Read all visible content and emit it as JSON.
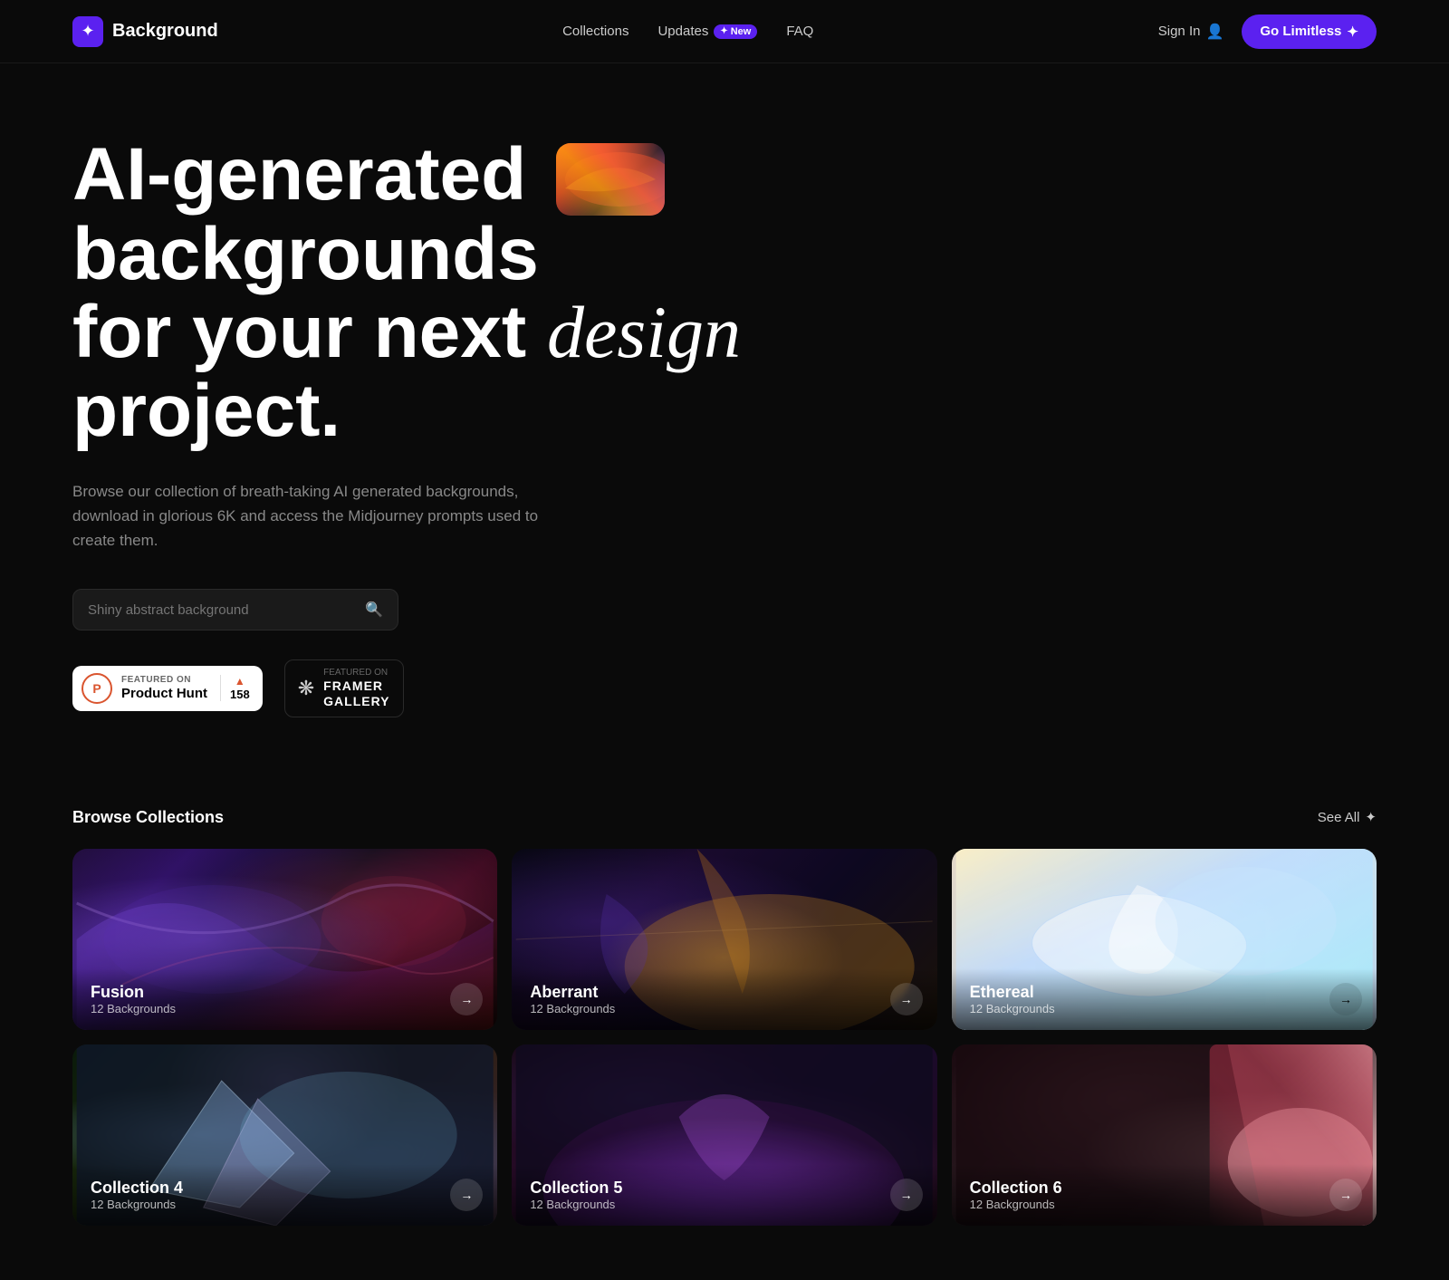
{
  "nav": {
    "logo_icon": "✦",
    "logo_text": "Background",
    "links": [
      {
        "label": "Collections",
        "badge": null
      },
      {
        "label": "Updates",
        "badge": "New"
      },
      {
        "label": "FAQ",
        "badge": null
      }
    ],
    "sign_in": "Sign In",
    "cta_label": "Go Limitless",
    "cta_icon": "✦"
  },
  "hero": {
    "title_line1_pre": "AI-generated",
    "title_line1_post": "backgrounds",
    "title_line2_pre": "for your next",
    "title_line2_italic": "design",
    "title_line2_post": "project.",
    "subtitle": "Browse our collection of breath-taking AI generated backgrounds, download in glorious 6K and access the Midjourney prompts used to create them.",
    "search_placeholder": "Shiny abstract background",
    "search_icon": "🔍"
  },
  "badges": {
    "ph_featured_label": "FEATURED ON",
    "ph_name": "Product Hunt",
    "ph_count": "158",
    "ph_arrow": "▲",
    "framer_featured_label": "Featured on",
    "framer_name": "FRAMER\nGALLERY"
  },
  "collections": {
    "section_title": "Browse Collections",
    "see_all_label": "See All",
    "items": [
      {
        "name": "Fusion",
        "count": "12 Backgrounds",
        "style": "fusion"
      },
      {
        "name": "Aberrant",
        "count": "12 Backgrounds",
        "style": "aberrant"
      },
      {
        "name": "Ethereal",
        "count": "12 Backgrounds",
        "style": "ethereal"
      },
      {
        "name": "Collection 4",
        "count": "12 Backgrounds",
        "style": "bottom1"
      },
      {
        "name": "Collection 5",
        "count": "12 Backgrounds",
        "style": "bottom2"
      },
      {
        "name": "Collection 6",
        "count": "12 Backgrounds",
        "style": "bottom3"
      }
    ]
  }
}
